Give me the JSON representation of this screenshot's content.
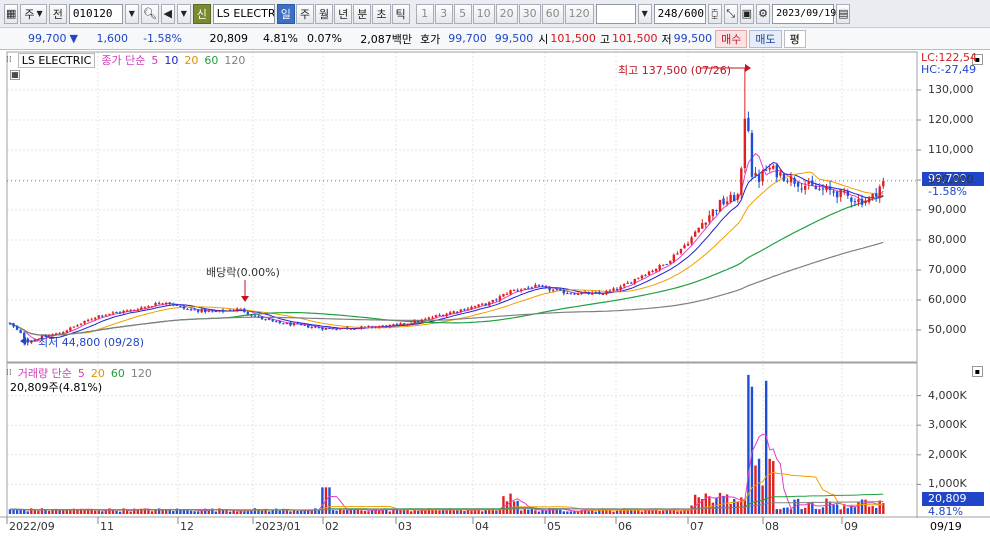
{
  "toolbar": {
    "type_label": "주",
    "prev_label": "전",
    "code": "010120",
    "name": "LS ELECTRIC",
    "shin_label": "신",
    "periods": [
      "일",
      "주",
      "월",
      "년",
      "분",
      "초",
      "틱"
    ],
    "intervals": [
      "1",
      "3",
      "5",
      "10",
      "20",
      "30",
      "60",
      "120"
    ],
    "count": "248",
    "max_count": "/600",
    "date": "2023/09/19"
  },
  "quote": {
    "price": "99,700",
    "change": "1,600",
    "change_pct": "-1.58%",
    "volume": "20,809",
    "vol_ratio": "4.81%",
    "turnover_pct": "0.07%",
    "amount": "2,087백만",
    "bid_label": "호가",
    "ask_price": "99,700",
    "bid_price": "99,500",
    "open_label": "시",
    "open": "101,500",
    "high_label": "고",
    "high": "101,500",
    "low_label": "저",
    "low": "99,500",
    "buy_label": "매수",
    "sell_label": "매도",
    "eval_label": "평"
  },
  "price_panel": {
    "name": "LS ELECTRIC",
    "ma_label": "종가 단순",
    "ma_periods": [
      "5",
      "10",
      "20",
      "60",
      "120"
    ],
    "lc": "LC:122,54",
    "hc": "HC:-27,49",
    "current_box": "99,700",
    "current_pct": "-1.58%",
    "high_annotation": "최고 137,500 (07/26)",
    "low_annotation": "최저 44,800 (09/28)",
    "dividend_annotation": "배당락(0.00%)",
    "y_ticks": [
      "130,000",
      "120,000",
      "110,000",
      "100,000",
      "90,000",
      "80,000",
      "70,000",
      "60,000",
      "50,000"
    ]
  },
  "volume_panel": {
    "label": "거래량 단순",
    "ma_periods": [
      "5",
      "20",
      "60",
      "120"
    ],
    "summary": "20,809주(4.81%)",
    "y_ticks": [
      "4,000K",
      "3,000K",
      "2,000K",
      "1,000K"
    ],
    "current_box": "20,809",
    "current_pct": "4.81%"
  },
  "x_axis": {
    "labels": [
      "2022/09",
      "11",
      "12",
      "2023/01",
      "02",
      "03",
      "04",
      "05",
      "06",
      "07",
      "08",
      "09"
    ],
    "right_label": "09/19"
  },
  "colors": {
    "up": "#e02020",
    "down": "#1f4fd8",
    "ma5": "#e040c8",
    "ma10": "#2020d0",
    "ma20": "#f0a000",
    "ma60": "#20a040",
    "ma120": "#808080"
  },
  "chart_data": {
    "type": "candlestick",
    "title": "LS ELECTRIC",
    "ylim": [
      42000,
      140000
    ],
    "weekly_close_approx": [
      [
        "2022/09",
        52000
      ],
      [
        "2022/10",
        47000
      ],
      [
        "2022/11",
        54000
      ],
      [
        "2022/12",
        58000
      ],
      [
        "2023/01",
        53000
      ],
      [
        "2023/02",
        51000
      ],
      [
        "2023/03",
        51500
      ],
      [
        "2023/04",
        63000
      ],
      [
        "2023/05",
        62000
      ],
      [
        "2023/06",
        65000
      ],
      [
        "2023/07",
        90000
      ],
      [
        "2023/07/26",
        137500
      ],
      [
        "2023/08",
        100000
      ],
      [
        "2023/09",
        99700
      ]
    ]
  }
}
